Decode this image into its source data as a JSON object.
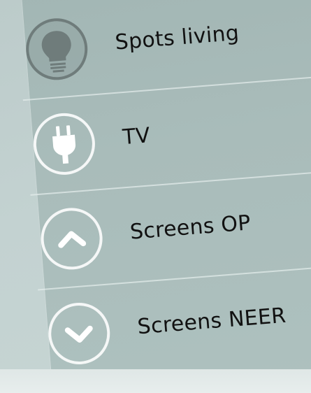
{
  "menu": {
    "items": [
      {
        "label": "Spots living",
        "icon": "lightbulb-icon",
        "active": true
      },
      {
        "label": "TV",
        "icon": "plug-icon",
        "active": false
      },
      {
        "label": "Screens OP",
        "icon": "chevron-up-icon",
        "active": false
      },
      {
        "label": "Screens NEER",
        "icon": "chevron-down-icon",
        "active": false
      }
    ]
  },
  "colors": {
    "panel": "#a9bcba",
    "active_ring": "#6f7c7b",
    "ring": "#ffffff",
    "text": "#111111"
  }
}
